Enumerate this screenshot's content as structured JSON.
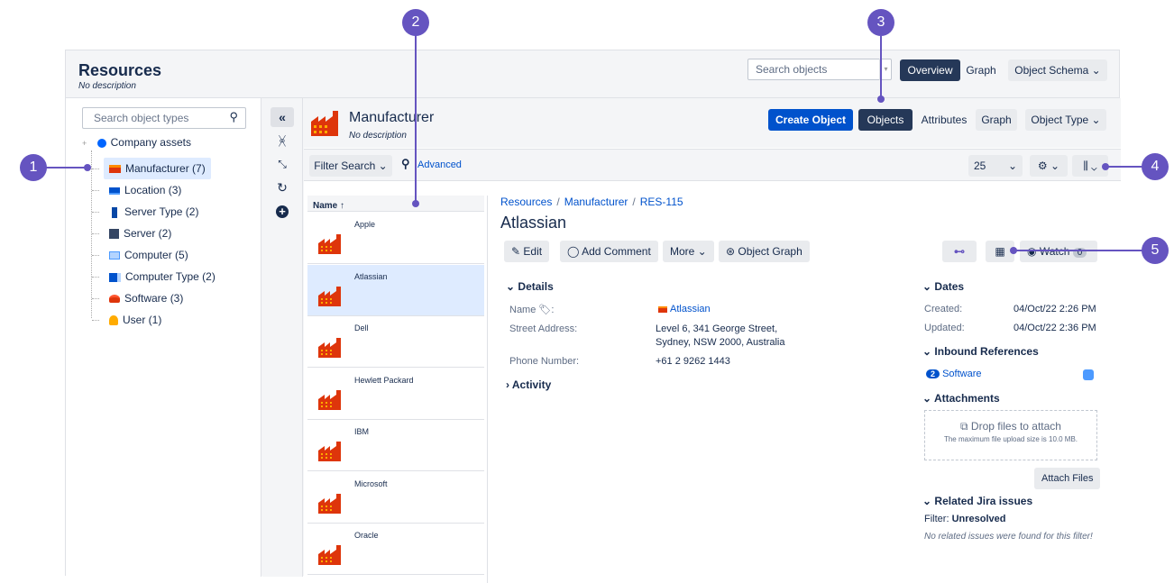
{
  "app": {
    "title": "Resources",
    "description": "No description"
  },
  "header": {
    "search_placeholder": "Search objects",
    "tabs": [
      "Overview",
      "Graph",
      "Object Schema ⌄"
    ]
  },
  "sidebar": {
    "search_placeholder": "Search object types",
    "root": "Company assets",
    "items": [
      {
        "label": "Manufacturer (7)"
      },
      {
        "label": "Location (3)"
      },
      {
        "label": "Server Type (2)"
      },
      {
        "label": "Server (2)"
      },
      {
        "label": "Computer (5)"
      },
      {
        "label": "Computer Type (2)"
      },
      {
        "label": "Software (3)"
      },
      {
        "label": "User (1)"
      }
    ]
  },
  "object_type": {
    "title": "Manufacturer",
    "description": "No description",
    "create_button": "Create Object",
    "tabs": [
      "Objects",
      "Attributes",
      "Graph",
      "Object Type ⌄"
    ]
  },
  "filterbar": {
    "filter_label": "Filter Search ⌄",
    "advanced": "Advanced",
    "page_size": "25"
  },
  "list": {
    "header": "Name ↑",
    "rows": [
      "Apple",
      "Atlassian",
      "Dell",
      "Hewlett Packard",
      "IBM",
      "Microsoft",
      "Oracle"
    ]
  },
  "detail": {
    "breadcrumb": [
      "Resources",
      "Manufacturer",
      "RES-115"
    ],
    "title": "Atlassian",
    "actions": {
      "edit": "Edit",
      "comment": "Add Comment",
      "more": "More ⌄",
      "graph": "Object Graph",
      "watch": "Watch",
      "watch_count": "0"
    },
    "details_heading": "Details",
    "fields": [
      {
        "label": "Name 🏷:",
        "value": "Atlassian"
      },
      {
        "label": "Street Address:",
        "value": "Level 6, 341 George Street,",
        "value2": "Sydney, NSW 2000, Australia"
      },
      {
        "label": "Phone Number:",
        "value": "+61 2 9262 1443"
      }
    ],
    "activity_heading": "Activity",
    "dates_heading": "Dates",
    "created_label": "Created:",
    "created_value": "04/Oct/22 2:26 PM",
    "updated_label": "Updated:",
    "updated_value": "04/Oct/22 2:36 PM",
    "inbound_heading": "Inbound References",
    "inbound_count": "2",
    "inbound_item": "Software",
    "attachments_heading": "Attachments",
    "drop_text": "Drop files to attach",
    "drop_sub": "The maximum file upload size is 10.0 MB.",
    "attach_button": "Attach Files",
    "jira_heading": "Related Jira issues",
    "filter_label": "Filter:",
    "filter_value": "Unresolved",
    "no_issues": "No related issues were found for this filter!"
  },
  "callouts": [
    "1",
    "2",
    "3",
    "4",
    "5"
  ],
  "colors": {
    "accent": "#0052cc",
    "callout": "#6554c0",
    "selected": "#deebff",
    "dark": "#253858"
  }
}
